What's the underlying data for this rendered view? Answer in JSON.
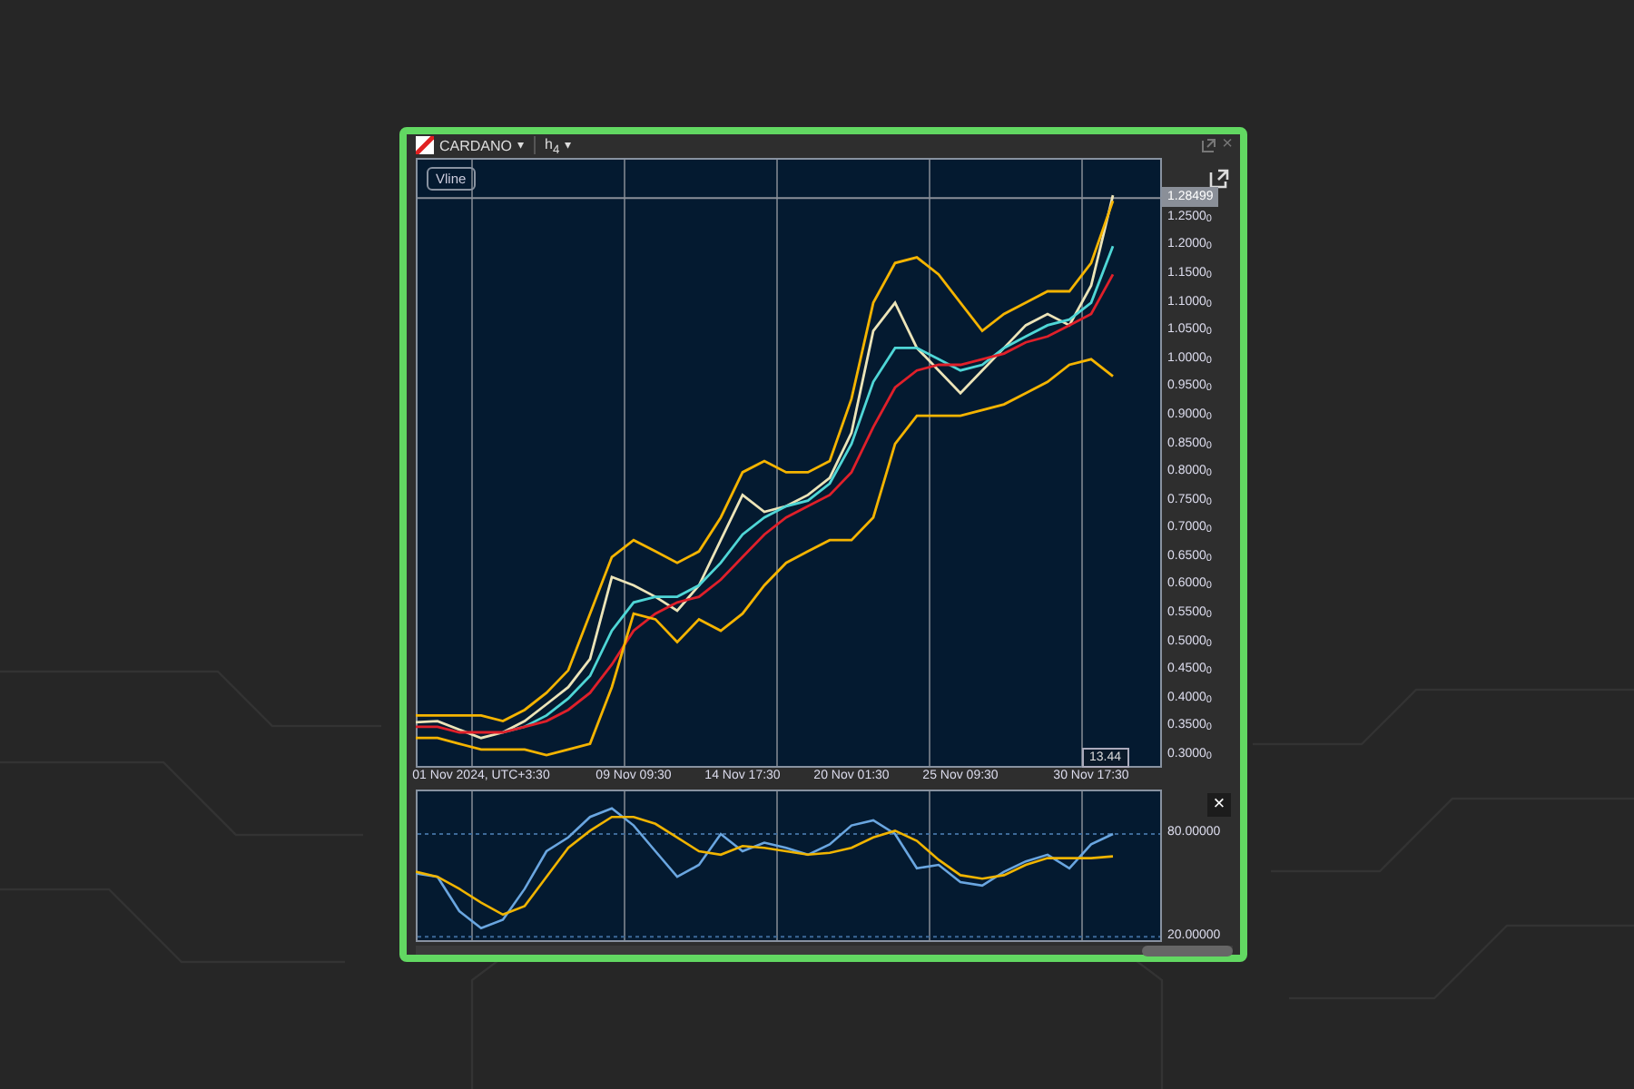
{
  "window": {
    "symbol": "CARDANO",
    "symbol_caret": "▾",
    "timeframe": "h$_{4}$",
    "timeframe_caret": "▾",
    "close": "×"
  },
  "price_chart": {
    "vline_button": "Vline",
    "current_price": "1.28499",
    "countdown": "13.44",
    "chart_data": {
      "type": "line",
      "categories": [
        null,
        null,
        null,
        "01 Nov 2024, UTC+3:30",
        null,
        null,
        null,
        null,
        null,
        null,
        "09 Nov 09:30",
        null,
        null,
        null,
        null,
        "14 Nov 17:30",
        null,
        null,
        null,
        null,
        "20 Nov 01:30",
        null,
        null,
        null,
        null,
        "25 Nov 09:30",
        null,
        null,
        null,
        null,
        null,
        "30 Nov 17:30",
        null
      ],
      "ylim": [
        0.2775,
        1.356
      ],
      "ref_lines": [
        {
          "axis": "y",
          "value": 1.28499
        }
      ],
      "series": [
        {
          "color": "#ece4b8",
          "values": [
            0.358,
            0.36,
            0.345,
            0.33,
            0.34,
            0.36,
            0.39,
            0.42,
            0.47,
            0.615,
            0.6,
            0.58,
            0.555,
            0.6,
            0.68,
            0.76,
            0.73,
            0.74,
            0.76,
            0.79,
            0.87,
            1.05,
            1.1,
            1.02,
            0.98,
            0.94,
            0.98,
            1.02,
            1.06,
            1.08,
            1.06,
            1.13,
            1.29
          ]
        },
        {
          "color": "#f5b400",
          "values": [
            0.37,
            0.37,
            0.37,
            0.37,
            0.36,
            0.38,
            0.41,
            0.45,
            0.55,
            0.65,
            0.68,
            0.66,
            0.64,
            0.66,
            0.72,
            0.8,
            0.82,
            0.8,
            0.8,
            0.82,
            0.93,
            1.1,
            1.17,
            1.18,
            1.15,
            1.1,
            1.05,
            1.08,
            1.1,
            1.12,
            1.12,
            1.17,
            1.28
          ]
        },
        {
          "color": "#4fd6d6",
          "values": [
            null,
            null,
            null,
            null,
            0.34,
            0.35,
            0.37,
            0.4,
            0.44,
            0.52,
            0.57,
            0.58,
            0.58,
            0.6,
            0.64,
            0.69,
            0.72,
            0.74,
            0.75,
            0.78,
            0.85,
            0.96,
            1.02,
            1.02,
            1.0,
            0.98,
            0.99,
            1.02,
            1.04,
            1.06,
            1.07,
            1.1,
            1.2
          ]
        },
        {
          "color": "#e0202a",
          "values": [
            0.35,
            0.35,
            0.34,
            0.34,
            0.34,
            0.35,
            0.36,
            0.38,
            0.41,
            0.46,
            0.52,
            0.55,
            0.57,
            0.58,
            0.61,
            0.65,
            0.69,
            0.72,
            0.74,
            0.76,
            0.8,
            0.88,
            0.95,
            0.98,
            0.99,
            0.99,
            1.0,
            1.01,
            1.03,
            1.04,
            1.06,
            1.08,
            1.15
          ]
        },
        {
          "color": "#f5b400",
          "values": [
            0.33,
            0.33,
            0.32,
            0.31,
            0.31,
            0.31,
            0.3,
            0.31,
            0.32,
            0.42,
            0.55,
            0.54,
            0.5,
            0.54,
            0.52,
            0.55,
            0.6,
            0.64,
            0.66,
            0.68,
            0.68,
            0.72,
            0.85,
            0.9,
            0.9,
            0.9,
            0.91,
            0.92,
            0.94,
            0.96,
            0.99,
            1.0,
            0.97
          ]
        }
      ],
      "yticks": [
        {
          "value": 0.3,
          "label": "0.30000"
        },
        {
          "value": 0.35,
          "label": "0.35000"
        },
        {
          "value": 0.4,
          "label": "0.40000"
        },
        {
          "value": 0.45,
          "label": "0.45000"
        },
        {
          "value": 0.5,
          "label": "0.50000"
        },
        {
          "value": 0.55,
          "label": "0.55000"
        },
        {
          "value": 0.6,
          "label": "0.60000"
        },
        {
          "value": 0.65,
          "label": "0.65000"
        },
        {
          "value": 0.7,
          "label": "0.70000"
        },
        {
          "value": 0.75,
          "label": "0.75000"
        },
        {
          "value": 0.8,
          "label": "0.80000"
        },
        {
          "value": 0.85,
          "label": "0.85000"
        },
        {
          "value": 0.9,
          "label": "0.90000"
        },
        {
          "value": 0.95,
          "label": "0.95000"
        },
        {
          "value": 1.0,
          "label": "1.00000"
        },
        {
          "value": 1.05,
          "label": "1.05000"
        },
        {
          "value": 1.1,
          "label": "1.10000"
        },
        {
          "value": 1.15,
          "label": "1.15000"
        },
        {
          "value": 1.2,
          "label": "1.20000"
        },
        {
          "value": 1.25,
          "label": "1.25000"
        }
      ]
    }
  },
  "oscillator": {
    "close": "×",
    "chart_data": {
      "type": "line",
      "ylim": [
        17,
        106
      ],
      "series": [
        {
          "color": "#6aa6e0",
          "values": [
            57,
            55,
            35,
            25,
            30,
            48,
            70,
            78,
            90,
            95,
            85,
            70,
            55,
            62,
            80,
            70,
            75,
            72,
            68,
            74,
            85,
            88,
            80,
            60,
            62,
            52,
            50,
            58,
            64,
            68,
            60,
            74,
            80
          ]
        },
        {
          "color": "#f0b400",
          "values": [
            58,
            55,
            48,
            40,
            33,
            38,
            55,
            72,
            82,
            90,
            90,
            86,
            78,
            70,
            68,
            73,
            72,
            70,
            68,
            69,
            72,
            78,
            82,
            76,
            65,
            56,
            54,
            56,
            62,
            66,
            66,
            66,
            67
          ]
        }
      ],
      "yticks": [
        {
          "value": 80,
          "label": "80.00000"
        },
        {
          "value": 20,
          "label": "20.00000"
        }
      ]
    }
  }
}
